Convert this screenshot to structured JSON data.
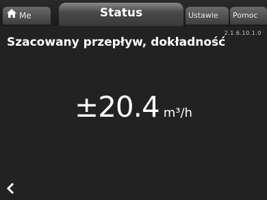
{
  "tabs": {
    "menu_label": "Me",
    "status_label": "Status",
    "settings_label": "Ustawie",
    "help_label": "Pomoc"
  },
  "screen": {
    "id": "2.1.6.10.1.0",
    "title": "Szacowany przepływ, dokładność",
    "value": "±20.4",
    "unit": "m³/h"
  },
  "icons": {
    "home": "home-icon",
    "back": "back-chevron-icon"
  },
  "colors": {
    "background": "#222222",
    "text": "#ffffff",
    "tab_gradient_top": "#8a8a8a"
  }
}
